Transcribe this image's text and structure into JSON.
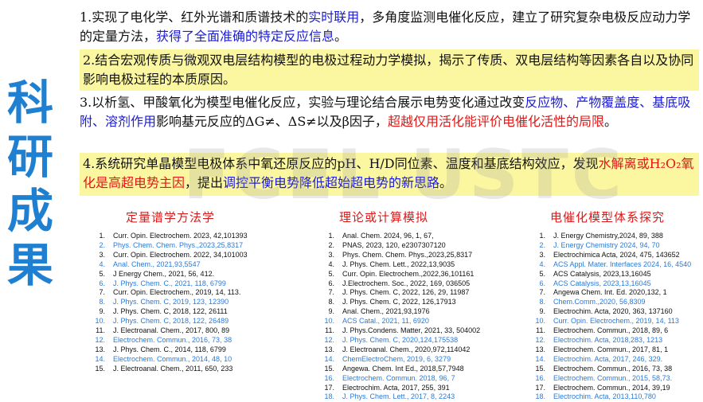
{
  "side_title": [
    "科",
    "研",
    "成",
    "果"
  ],
  "watermark": "FCEL USTC",
  "paragraphs": [
    {
      "highlight": false,
      "segments": [
        {
          "text": "1.实现了电化学、红外光谱和质谱技术的",
          "color": "black"
        },
        {
          "text": "实时联用",
          "color": "blue"
        },
        {
          "text": "，多角度监测电催化反应，建立了研究复杂电极反应动力学的定量方法，",
          "color": "black"
        },
        {
          "text": "获得了全面准确的特定反应信息",
          "color": "blue"
        },
        {
          "text": "。",
          "color": "black"
        }
      ]
    },
    {
      "highlight": true,
      "segments": [
        {
          "text": "2.结合宏观传质与微观双电层结构模型的电极过程动力学模拟，揭示了传质、双电层结构等因素各自以及协同影响电极过程的本质原因。",
          "color": "black"
        }
      ]
    },
    {
      "highlight": false,
      "segments": [
        {
          "text": "3.以析氢、甲酸氧化为模型电催化反应，实验与理论结合展示电势变化通过改变",
          "color": "black"
        },
        {
          "text": "反应物、产物覆盖度、基底吸附、溶剂作用",
          "color": "blue"
        },
        {
          "text": "影响基元反应的ΔG≠、ΔS≠以及β因子，",
          "color": "black"
        },
        {
          "text": "超越仅用活化能评价电催化活性的局限",
          "color": "red"
        },
        {
          "text": "。",
          "color": "black"
        }
      ]
    },
    {
      "highlight": true,
      "segments": [
        {
          "text": "4.系统研究单晶模型电极体系中氧还原反应的pH、H/D同位素、温度和基底结构效应，发现",
          "color": "black"
        },
        {
          "text": "水解离或H₂O₂氧化是高超电势主因",
          "color": "red"
        },
        {
          "text": "，提出",
          "color": "black"
        },
        {
          "text": "调控平衡电势降低超始超电势的新思路",
          "color": "blue"
        },
        {
          "text": "。",
          "color": "black"
        }
      ]
    }
  ],
  "columns": [
    {
      "heading": "定量谱学方法学",
      "refs": [
        {
          "n": "1.",
          "text": "Curr. Opin. Electrochem. 2023, 42,101393",
          "blue": false
        },
        {
          "n": "2.",
          "text": "Phys. Chem. Chem. Phys.,2023,25,8317",
          "blue": true
        },
        {
          "n": "3.",
          "text": "Curr. Opin. Electrochem. 2022, 34,101003",
          "blue": false
        },
        {
          "n": "4.",
          "text": "Anal. Chem., 2021,93,5547",
          "blue": true
        },
        {
          "n": "5.",
          "text": "J Energy Chem., 2021, 56, 412.",
          "blue": false
        },
        {
          "n": "6.",
          "text": "J. Phys. Chem. C., 2021, 118, 6799",
          "blue": true
        },
        {
          "n": "7.",
          "text": "Curr. Opin. Electrochem., 2019, 14, 113.",
          "blue": false
        },
        {
          "n": "8.",
          "text": "J. Phys. Chem. C, 2019, 123, 12390",
          "blue": true
        },
        {
          "n": "9.",
          "text": "J. Phys. Chem. C, 2018, 122, 26111",
          "blue": false
        },
        {
          "n": "10.",
          "text": "J. Phys. Chem. C, 2018, 122, 26489",
          "blue": true
        },
        {
          "n": "11.",
          "text": "J. Electroanal. Chem., 2017, 800, 89",
          "blue": false
        },
        {
          "n": "12.",
          "text": "Electrochem. Commun., 2016, 73, 38",
          "blue": true
        },
        {
          "n": "13.",
          "text": "J. Phys. Chem. C., 2014, 118, 6799",
          "blue": false
        },
        {
          "n": "14.",
          "text": "Electrochem. Commun., 2014, 48, 10",
          "blue": true
        },
        {
          "n": "15.",
          "text": "J. Electroanal. Chem., 2011, 650, 233",
          "blue": false
        }
      ]
    },
    {
      "heading": "理论或计算模拟",
      "refs": [
        {
          "n": "1.",
          "text": "Anal. Chem. 2024, 96, 1, 67,",
          "blue": false
        },
        {
          "n": "2.",
          "text": "PNAS, 2023, 120, e2307307120",
          "blue": false
        },
        {
          "n": "3.",
          "text": "Phys. Chem. Chem. Phys.,2023,25,8317",
          "blue": false
        },
        {
          "n": "4.",
          "text": "J. Phys. Chem. Lett., 2022,13,9035",
          "blue": false
        },
        {
          "n": "5.",
          "text": "Curr. Opin. Electrochem.,2022,36,101161",
          "blue": false
        },
        {
          "n": "6.",
          "text": "J.Electrochem. Soc., 2022, 169, 036505",
          "blue": false
        },
        {
          "n": "7.",
          "text": "J. Phys. Chem. C, 2022, 126, 29, 11987",
          "blue": false
        },
        {
          "n": "8.",
          "text": "J. Phys. Chem. C, 2022, 126,17913",
          "blue": false
        },
        {
          "n": "9.",
          "text": "Anal. Chem., 2021,93,1976",
          "blue": false
        },
        {
          "n": "10.",
          "text": "ACS Catal., 2021, 11, 6920",
          "blue": true
        },
        {
          "n": "11.",
          "text": "J. Phys.Condens. Matter, 2021, 33, 504002",
          "blue": false
        },
        {
          "n": "12.",
          "text": "J. Phys. Chem. C, 2020,124,175538",
          "blue": true
        },
        {
          "n": "13.",
          "text": "J. Electroanal. Chem., 2020,972,114042",
          "blue": false
        },
        {
          "n": "14.",
          "text": "ChemElectroChem, 2019, 6, 3279",
          "blue": true
        },
        {
          "n": "15.",
          "text": "Angewa. Chem. Int Ed., 2018,57,7948",
          "blue": false
        },
        {
          "n": "16.",
          "text": "Electrochem. Commun. 2018, 96, 7",
          "blue": true
        },
        {
          "n": "17.",
          "text": "Electrochim. Acta, 2017, 255, 391",
          "blue": false
        },
        {
          "n": "18.",
          "text": "J. Phys. Chem. Lett., 2017, 8, 2243",
          "blue": true
        }
      ]
    },
    {
      "heading": "电催化模型体系探究",
      "refs": [
        {
          "n": "1.",
          "text": "J. Energy Chemistry,2024, 89, 388",
          "blue": false
        },
        {
          "n": "2.",
          "text": "J. Energy Chemistry 2024, 94, 70",
          "blue": true
        },
        {
          "n": "3.",
          "text": "Electrochimica Acta, 2024, 475, 143652",
          "blue": false
        },
        {
          "n": "4.",
          "text": "ACS Appl. Mater. Interfaces 2024, 16, 4540",
          "blue": true
        },
        {
          "n": "5.",
          "text": "ACS Catalysis, 2023,13,16045",
          "blue": false
        },
        {
          "n": "6.",
          "text": "ACS Catalysis, 2023,13,16045",
          "blue": true
        },
        {
          "n": "7.",
          "text": "Angewa Chem. Int. Ed. 2020,132, 1",
          "blue": false
        },
        {
          "n": "8.",
          "text": "Chem.Comm.,2020, 56,8309",
          "blue": true
        },
        {
          "n": "9.",
          "text": "Electrochim. Acta, 2020, 363, 137160",
          "blue": false
        },
        {
          "n": "10.",
          "text": "Curr. Opin. Electrochem., 2019, 14, 113",
          "blue": true
        },
        {
          "n": "11.",
          "text": "Electrochem. Commun., 2018, 89, 6",
          "blue": false
        },
        {
          "n": "12.",
          "text": "Electrochim. Acta, 2018,283, 1213",
          "blue": true
        },
        {
          "n": "13.",
          "text": "Electrochem. Commun., 2017, 81, 1",
          "blue": false
        },
        {
          "n": "14.",
          "text": "Electrochim. Acta, 2017, 246, 329.",
          "blue": true
        },
        {
          "n": "15.",
          "text": "Electrochem. Commun., 2016, 73, 38",
          "blue": false
        },
        {
          "n": "16.",
          "text": "Electrochem. Commun., 2015, 58,73.",
          "blue": true
        },
        {
          "n": "17.",
          "text": "Electrochem. Commun., 2014, 39,19",
          "blue": false
        },
        {
          "n": "18.",
          "text": "Electrochim. Acta, 2013,110,780",
          "blue": true
        }
      ]
    }
  ],
  "colors": {
    "side_title": "#1f7fd0",
    "highlight": "#fbf6a0",
    "blue_text": "#1a1ad8",
    "red_text": "#e01818",
    "ref_blue": "#2a7ad8"
  }
}
